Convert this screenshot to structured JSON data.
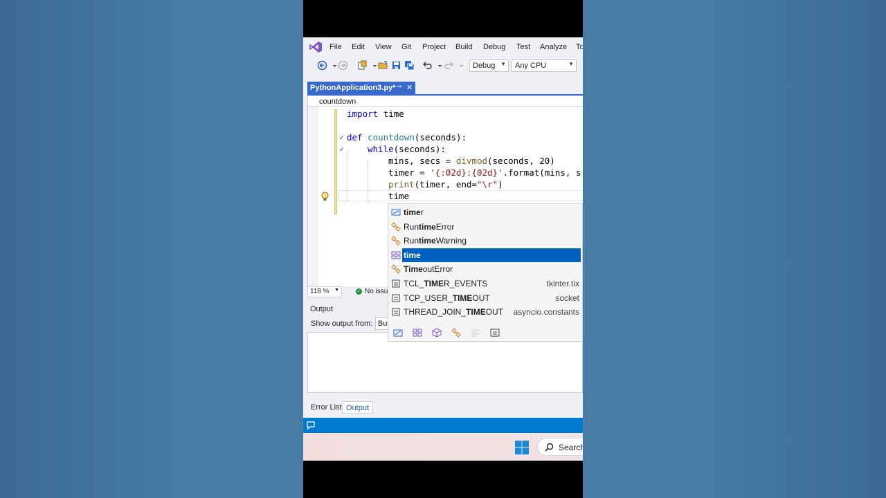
{
  "menubar": {
    "items": [
      "File",
      "Edit",
      "View",
      "Git",
      "Project",
      "Build",
      "Debug",
      "Test",
      "Analyze",
      "To"
    ]
  },
  "toolbar": {
    "config": "Debug",
    "platform": "Any CPU"
  },
  "tab": {
    "label": "PythonApplication3.py*",
    "pin": "⊸",
    "close": "✕"
  },
  "navbar": {
    "scope": "countdown"
  },
  "code": {
    "line1_kw": "import",
    "line1_rest": " time",
    "line3_kw": "def",
    "line3_fn": "countdown",
    "line3_rest": "(seconds):",
    "line4_kw": "while",
    "line4_rest": "(seconds):",
    "line5_a": "mins, secs = ",
    "line5_fn": "divmod",
    "line5_b": "(seconds, 20)",
    "line6_a": "timer = ",
    "line6_str": "'{:02d}:{02d}'",
    "line6_b": ".format(mins, s",
    "line7_fn": "print",
    "line7_a": "(timer, end=",
    "line7_str": "\"\\r\"",
    "line7_b": ")",
    "line8": "time"
  },
  "editor_status": {
    "zoom": "118 %",
    "issues": "No issu"
  },
  "output": {
    "title": "Output",
    "show_from_label": "Show output from:",
    "source": "Buil"
  },
  "bottom_tabs": [
    "Error List",
    "Output"
  ],
  "taskbar": {
    "search": "Search"
  },
  "intellisense": {
    "items": [
      {
        "pre": "",
        "bold": "time",
        "post": "r",
        "source": "",
        "icon": "variable-icon",
        "selected": false
      },
      {
        "pre": "Run",
        "bold": "time",
        "post": "Error",
        "source": "",
        "icon": "class-icon",
        "selected": false
      },
      {
        "pre": "Run",
        "bold": "time",
        "post": "Warning",
        "source": "",
        "icon": "class-icon",
        "selected": false
      },
      {
        "pre": "",
        "bold": "time",
        "post": "",
        "source": "",
        "icon": "module-icon",
        "selected": true
      },
      {
        "pre": "",
        "bold": "Time",
        "post": "outError",
        "source": "",
        "icon": "class-icon",
        "selected": false
      },
      {
        "pre": "TCL_",
        "bold": "TIME",
        "post": "R_EVENTS",
        "source": "tkinter.tix",
        "icon": "constant-icon",
        "selected": false
      },
      {
        "pre": "TCP_USER_",
        "bold": "TIME",
        "post": "OUT",
        "source": "socket",
        "icon": "constant-icon",
        "selected": false
      },
      {
        "pre": "THREAD_JOIN_",
        "bold": "TIME",
        "post": "OUT",
        "source": "asyncio.constants",
        "icon": "constant-icon",
        "selected": false
      }
    ]
  },
  "colors": {
    "accent": "#3a69cc",
    "selection": "#0060c0",
    "statusbar": "#007acc",
    "keyword": "#0000ff",
    "string": "#a31515"
  }
}
